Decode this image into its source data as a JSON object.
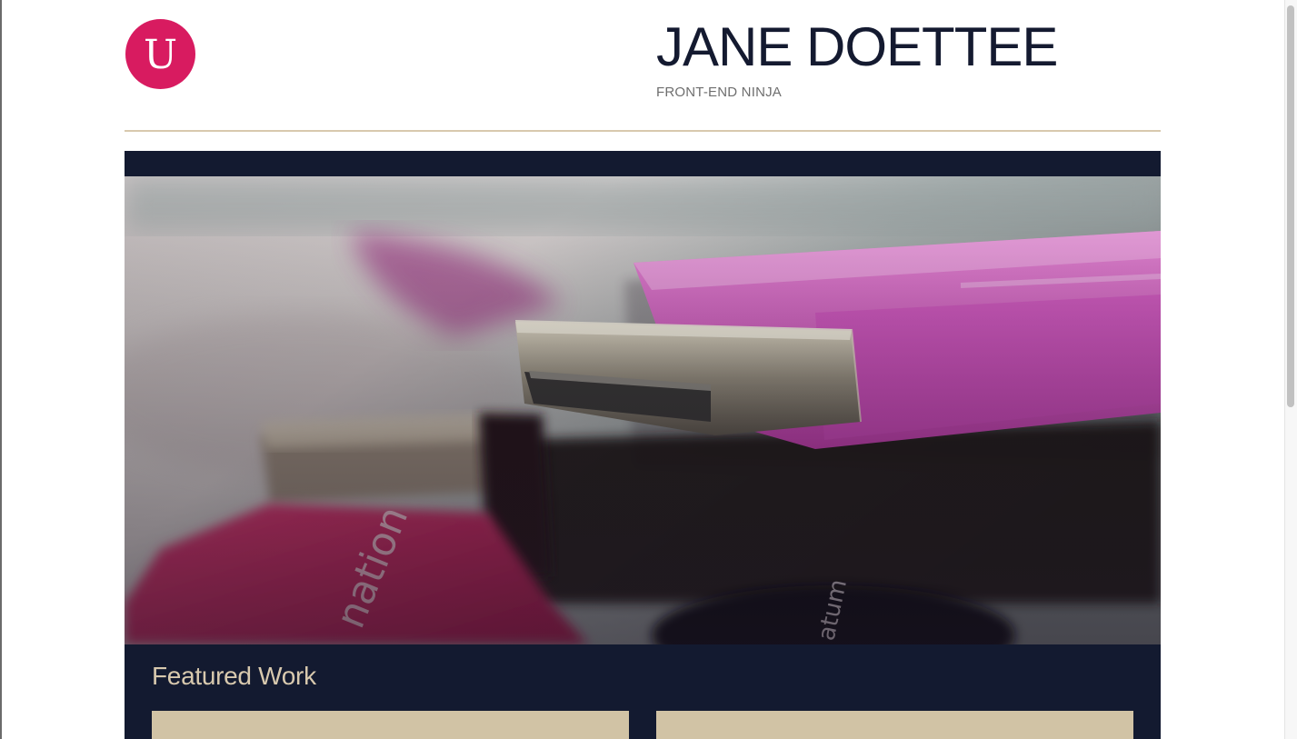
{
  "header": {
    "logo_letter": "U",
    "name": "JANE DOETTEE",
    "tagline": "FRONT-END NINJA"
  },
  "main": {
    "hero_alt": "Close-up of USB flash drives",
    "featured_title": "Featured Work",
    "work_items": [
      {
        "name": "featured-work-card-1"
      },
      {
        "name": "featured-work-card-2"
      }
    ]
  },
  "colors": {
    "accent": "#d81b60",
    "navy": "#131a30",
    "tan": "#d8c9ae",
    "card": "#d1c3a5"
  },
  "icons": {
    "logo": "u-monogram-icon"
  }
}
